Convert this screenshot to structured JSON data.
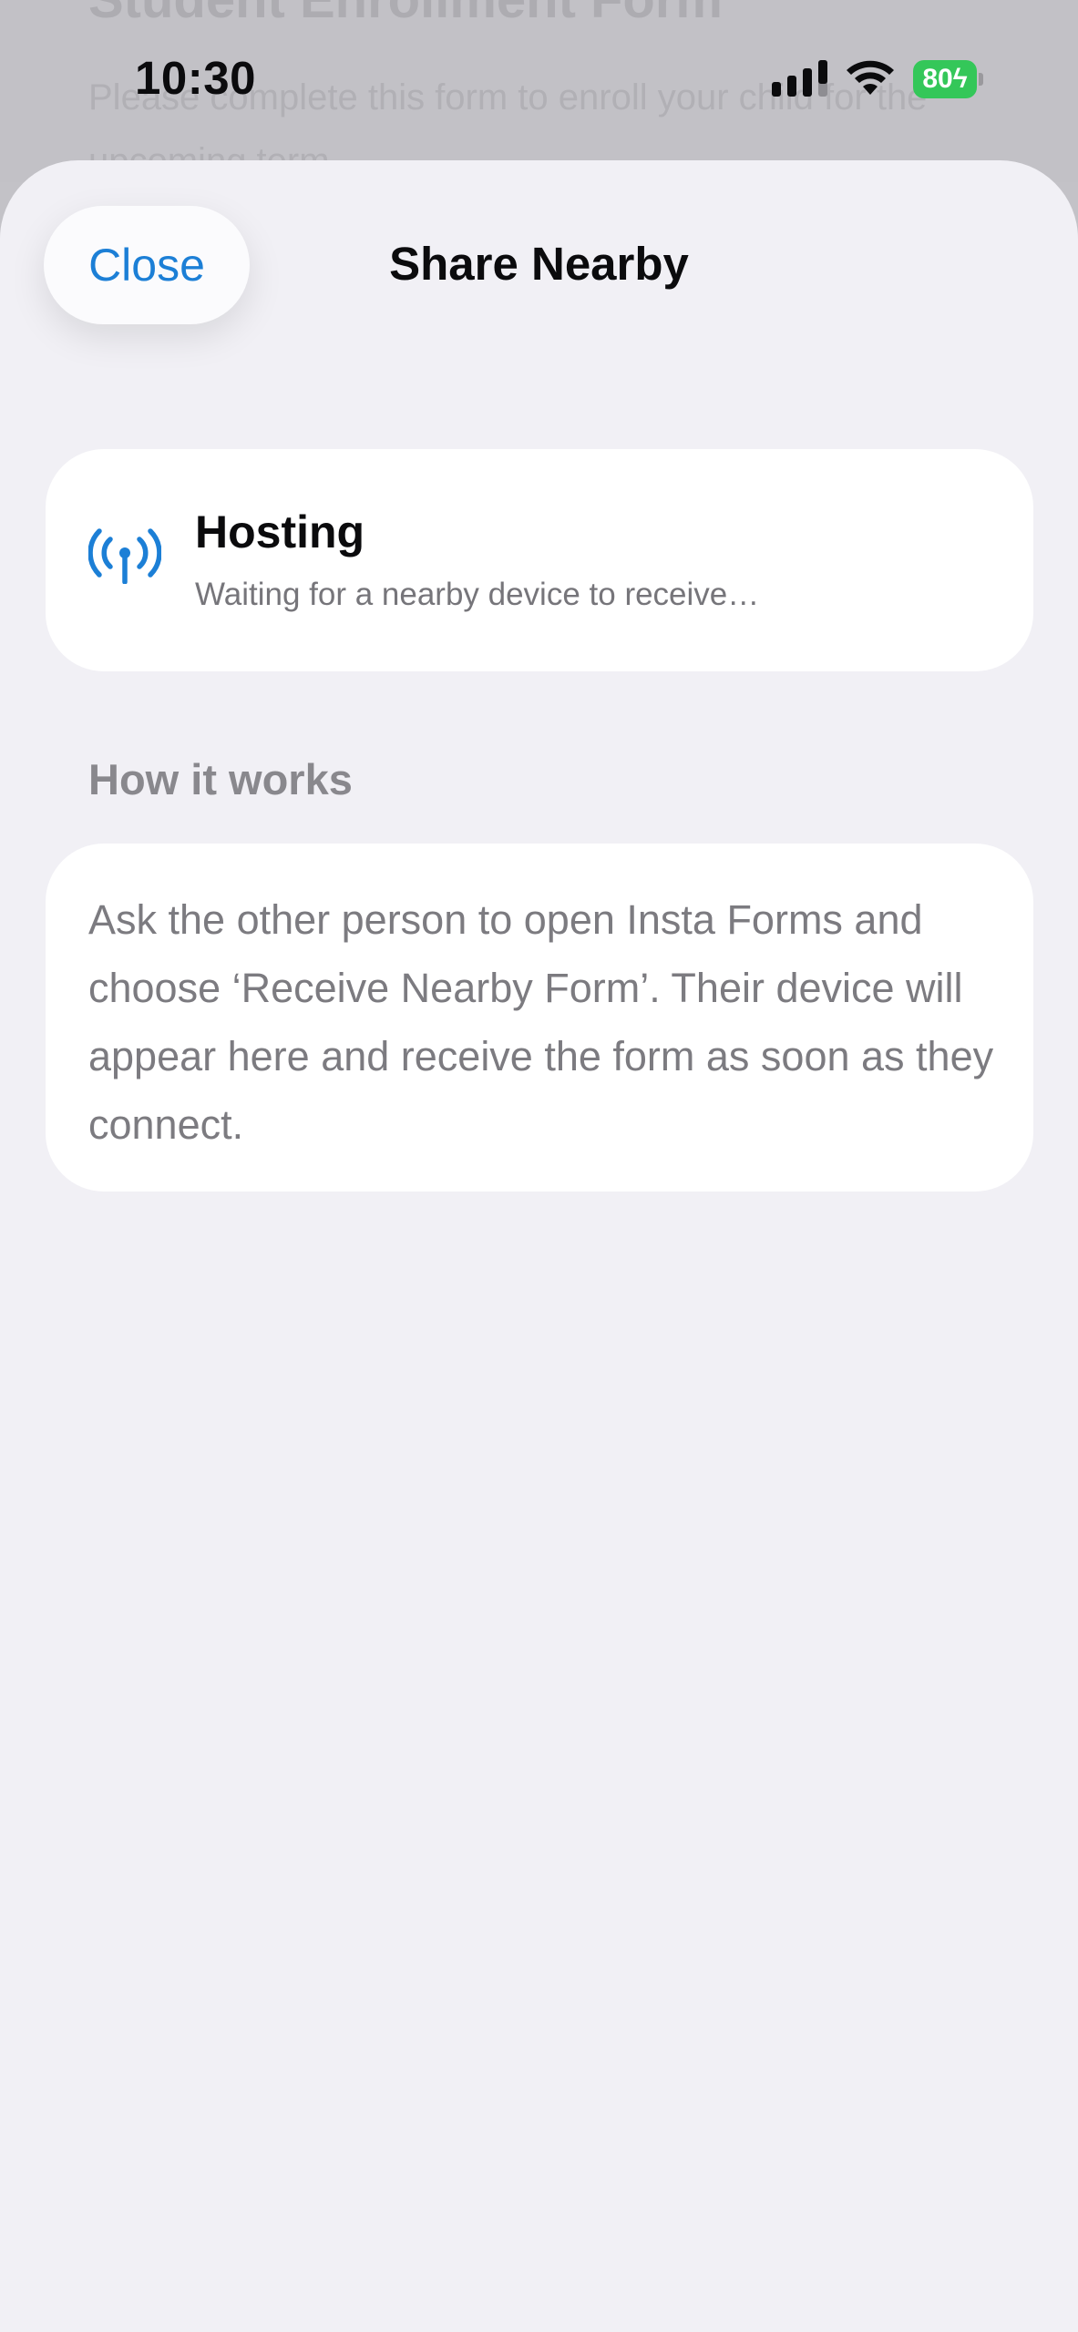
{
  "background_page": {
    "title": "Student Enrollment Form",
    "subtitle": "Please complete this form to enroll your child for the upcoming term."
  },
  "status_bar": {
    "time": "10:30",
    "battery": "80",
    "icons": [
      "signal-icon",
      "wifi-icon",
      "battery-charging-icon"
    ]
  },
  "sheet": {
    "title": "Share Nearby",
    "close_label": "Close"
  },
  "hosting": {
    "icon": "broadcast-antenna-icon",
    "title": "Hosting",
    "subtitle": "Waiting for a nearby device to receive…"
  },
  "how_it_works": {
    "header": "How it works",
    "body": "Ask the other person to open Insta Forms and choose ‘Receive Nearby Form’. Their device will appear here and receive the form as soon as they connect."
  },
  "colors": {
    "accent": "#1c7fd6",
    "battery": "#34c759",
    "sheet_background": "#f1f0f5"
  }
}
